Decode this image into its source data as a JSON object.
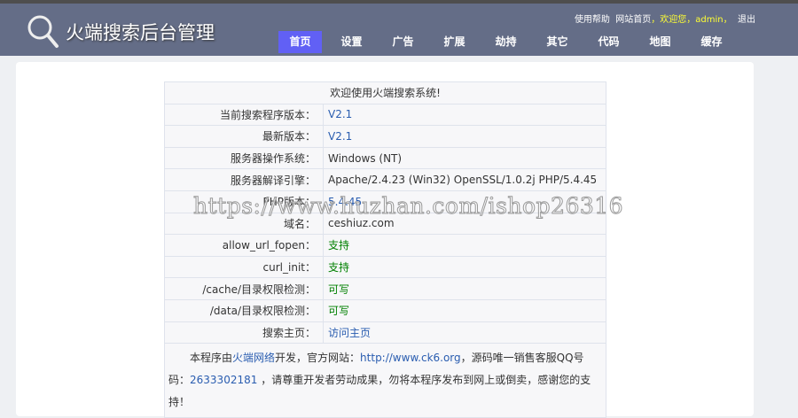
{
  "header": {
    "title": "火端搜索后台管理",
    "links": {
      "help": "使用帮助",
      "home": "网站首页",
      "sep": "，",
      "welcome": "欢迎您，",
      "user": "admin",
      "sep2": "，",
      "logout": "退出"
    }
  },
  "nav": [
    {
      "label": "首页",
      "active": true
    },
    {
      "label": "设置"
    },
    {
      "label": "广告"
    },
    {
      "label": "扩展"
    },
    {
      "label": "劫持"
    },
    {
      "label": "其它"
    },
    {
      "label": "代码"
    },
    {
      "label": "地图"
    },
    {
      "label": "缓存"
    }
  ],
  "table": {
    "title": "欢迎使用火端搜索系统!",
    "rows": [
      {
        "label": "当前搜索程序版本：",
        "value": "V2.1"
      },
      {
        "label": "最新版本：",
        "value": "V2.1"
      },
      {
        "label": "服务器操作系统：",
        "value": "Windows (NT)"
      },
      {
        "label": "服务器解译引擎：",
        "value": "Apache/2.4.23 (Win32) OpenSSL/1.0.2j PHP/5.4.45"
      },
      {
        "label": "PHP版本：",
        "value": "5.4.45"
      },
      {
        "label": "域名：",
        "value": "ceshiuz.com"
      },
      {
        "label": "allow_url_fopen：",
        "value": "支持"
      },
      {
        "label": "curl_init：",
        "value": "支持"
      },
      {
        "label": "/cache/目录权限检测：",
        "value": "可写"
      },
      {
        "label": "/data/目录权限检测：",
        "value": "可写"
      },
      {
        "label": "搜索主页：",
        "value": "访问主页"
      }
    ],
    "footer": {
      "t1": "本程序由",
      "dev": "火端网络",
      "t2": "开发，官方网站：",
      "site": "http://www.ck6.org",
      "t3": "，源码唯一销售客服QQ号码：",
      "qq": "2633302181",
      "t4": " ，请尊重开发者劳动成果，勿将本程序发布到网上或倒卖，感谢您的支持！"
    }
  },
  "watermark": "https://www.huzhan.com/ishop26316"
}
